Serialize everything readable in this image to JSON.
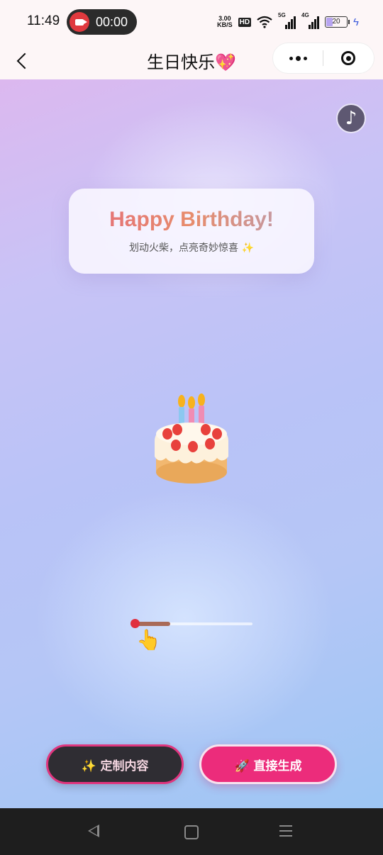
{
  "status_bar": {
    "time": "11:49",
    "recording_time": "00:00",
    "net_speed_value": "3.00",
    "net_speed_unit": "KB/S",
    "hd_badge": "HD",
    "signal_1_label": "5G",
    "signal_2_label": "4G",
    "battery_level": "20"
  },
  "header": {
    "title": "生日快乐💖"
  },
  "main": {
    "music_icon": "♪",
    "card_heading": "Happy Birthday!",
    "card_subtitle": "划动火柴，点亮奇妙惊喜 ✨",
    "hand_icon": "👆",
    "match_progress": 0.3
  },
  "buttons": {
    "custom_label": "✨ 定制内容",
    "generate_label": "🚀 直接生成"
  },
  "colors": {
    "accent_pink": "#ec2c7b",
    "dark_button": "#2f2d33"
  }
}
